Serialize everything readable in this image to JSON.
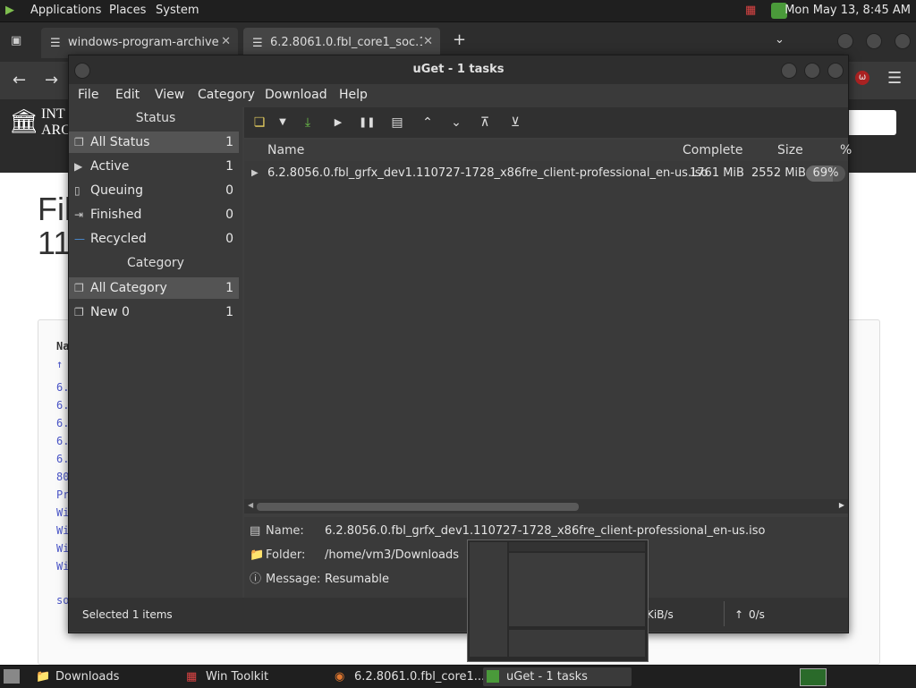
{
  "top_panel": {
    "menus": [
      "Applications",
      "Places",
      "System"
    ],
    "clock": "Mon May 13,  8:45 AM"
  },
  "browser": {
    "tabs": [
      {
        "label": "windows-program-archive"
      },
      {
        "label": "6.2.8061.0.fbl_core1_soc.11("
      }
    ],
    "new_tab_label": "+",
    "page": {
      "site_name_line1": "INT",
      "site_name_line2": "ARC",
      "title_line1": "Fil",
      "title_line2": "11",
      "list_header": "Na",
      "list_items": [
        "6.",
        "6.",
        "6.",
        "6.",
        "6.",
        "80",
        "Pr",
        "Wi",
        "Wi",
        "Wi",
        "Wi",
        "so"
      ]
    }
  },
  "uget": {
    "title": "uGet - 1 tasks",
    "menu": [
      "File",
      "Edit",
      "View",
      "Category",
      "Download",
      "Help"
    ],
    "status_header": "Status",
    "status_items": [
      {
        "label": "All Status",
        "count": "1"
      },
      {
        "label": "Active",
        "count": "1"
      },
      {
        "label": "Queuing",
        "count": "0"
      },
      {
        "label": "Finished",
        "count": "0"
      },
      {
        "label": "Recycled",
        "count": "0"
      }
    ],
    "category_header": "Category",
    "category_items": [
      {
        "label": "All Category",
        "count": "1"
      },
      {
        "label": "New 0",
        "count": "1"
      }
    ],
    "columns": {
      "name": "Name",
      "complete": "Complete",
      "size": "Size",
      "percent": "%"
    },
    "downloads": [
      {
        "name": "6.2.8056.0.fbl_grfx_dev1.110727-1728_x86fre_client-professional_en-us.iso",
        "complete": "1761 MiB",
        "size": "2552 MiB",
        "percent": "69%",
        "progress": 0.69
      }
    ],
    "details": {
      "name_label": "Name:",
      "name_value": "6.2.8056.0.fbl_grfx_dev1.110727-1728_x86fre_client-professional_en-us.iso",
      "folder_label": "Folder:",
      "folder_value": "/home/vm3/Downloads",
      "message_label": "Message:",
      "message_value": "Resumable"
    },
    "statusbar": {
      "selected": "Selected 1 items",
      "down_speed": "KiB/s",
      "up_speed": "0/s"
    }
  },
  "taskbar": {
    "items": [
      {
        "label": "Downloads"
      },
      {
        "label": "Win Toolkit"
      },
      {
        "label": "6.2.8061.0.fbl_core1..."
      },
      {
        "label": "uGet - 1 tasks"
      }
    ]
  }
}
